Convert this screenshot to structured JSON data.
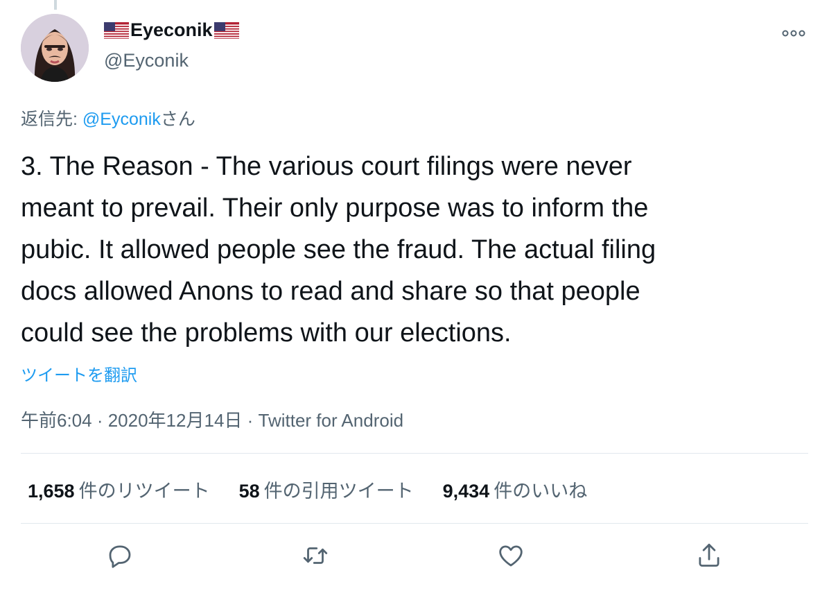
{
  "author": {
    "display_name": "Eyeconik",
    "handle": "@Eyconik"
  },
  "reply": {
    "prefix": "返信先: ",
    "mention": "@Eyconik",
    "suffix": "さん"
  },
  "tweet": {
    "text": "3. The Reason - The various court filings were never\nmeant to prevail. Their only purpose was to inform the\npubic. It allowed people see the fraud. The actual filing\ndocs allowed Anons to read and share so that people\ncould see the problems with our elections.",
    "translate_label": "ツイートを翻訳",
    "time": "午前6:04",
    "date": "2020年12月14日",
    "source": "Twitter for Android",
    "separator": " · "
  },
  "stats": {
    "retweets_count": "1,658",
    "retweets_label": "件のリツイート",
    "quotes_count": "58",
    "quotes_label": "件の引用ツイート",
    "likes_count": "9,434",
    "likes_label": "件のいいね"
  },
  "actions": [
    "reply-icon",
    "retweet-icon",
    "like-icon",
    "share-icon"
  ],
  "colors": {
    "accent": "#1d9bf0",
    "secondary_text": "#536471",
    "primary_text": "#0f1419",
    "divider": "#e1e8ed"
  }
}
